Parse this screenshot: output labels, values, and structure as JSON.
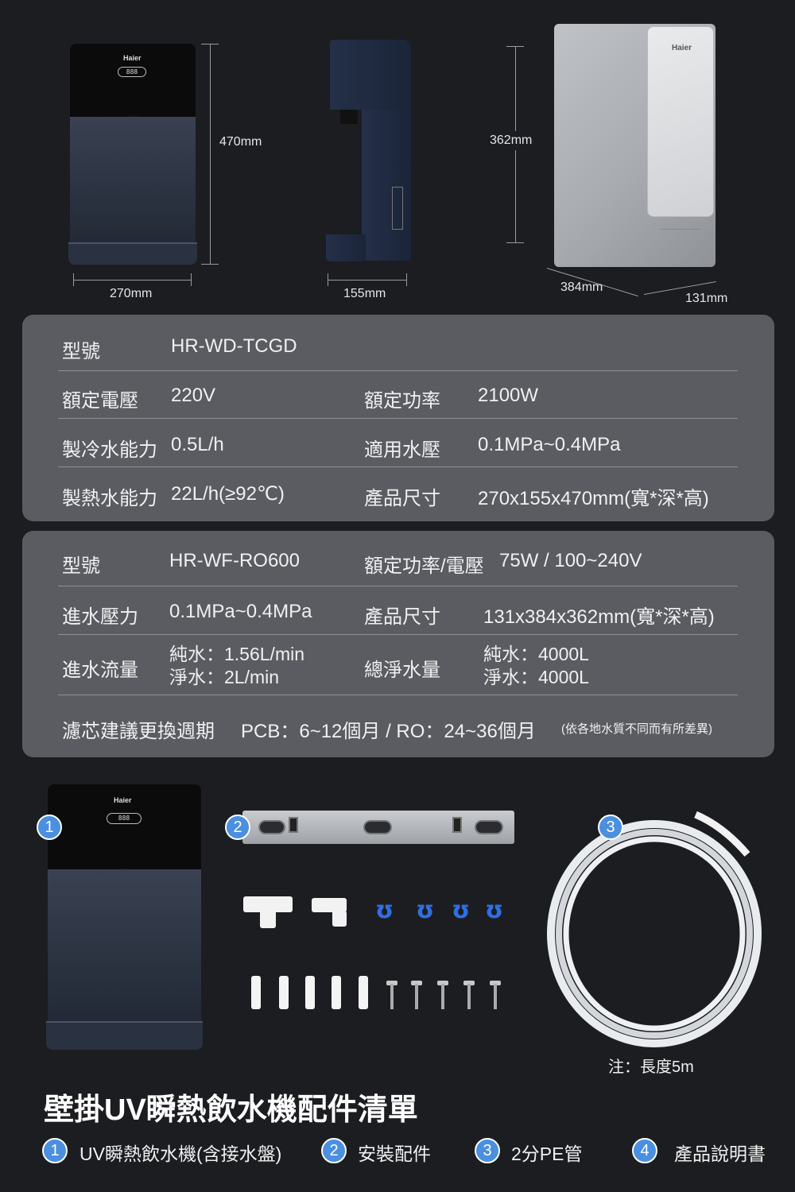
{
  "dimensions": {
    "dispenser_height": "470mm",
    "dispenser_width": "270mm",
    "dispenser_depth": "155mm",
    "purifier_height": "362mm",
    "purifier_depth": "384mm",
    "purifier_width": "131mm",
    "brand": "Haier",
    "display": "888"
  },
  "spec_dispenser": {
    "model_label": "型號",
    "model_value": "HR-WD-TCGD",
    "rows": [
      {
        "label_a": "額定電壓",
        "value_a": "220V",
        "label_b": "額定功率",
        "value_b": "2100W"
      },
      {
        "label_a": "製冷水能力",
        "value_a": "0.5L/h",
        "label_b": "適用水壓",
        "value_b": "0.1MPa~0.4MPa"
      },
      {
        "label_a": "製熱水能力",
        "value_a": "22L/h(≥92℃)",
        "label_b": "產品尺寸",
        "value_b": "270x155x470mm(寬*深*高)"
      }
    ]
  },
  "spec_purifier": {
    "model_label": "型號",
    "model_value": "HR-WF-RO600",
    "power_label": "額定功率/電壓",
    "power_value": "75W / 100~240V",
    "pressure_label": "進水壓力",
    "pressure_value": "0.1MPa~0.4MPa",
    "size_label": "產品尺寸",
    "size_value": "131x384x362mm(寬*深*高)",
    "flow_label": "進水流量",
    "flow_line1": "純水：1.56L/min",
    "flow_line2": "淨水：2L/min",
    "total_label": "總淨水量",
    "total_line1": "純水：4000L",
    "total_line2": "淨水：4000L",
    "filter_label": "濾芯建議更換週期",
    "filter_value": "PCB：6~12個月 / RO：24~36個月",
    "filter_note": "(依各地水質不同而有所差異)"
  },
  "accessories": {
    "markers": [
      "1",
      "2",
      "3"
    ],
    "pipe_note": "注：長度5m",
    "title": "壁掛UV瞬熱飲水機配件清單",
    "legend": [
      {
        "num": "1",
        "text": "UV瞬熱飲水機(含接水盤)"
      },
      {
        "num": "2",
        "text": "安裝配件"
      },
      {
        "num": "3",
        "text": "2分PE管"
      },
      {
        "num": "4",
        "text": "產品說明書"
      }
    ],
    "clip_glyph": "ʊ"
  },
  "colors": {
    "background": "#1c1d21",
    "panel": "#5a5c61",
    "accent_blue": "#4a8fe0",
    "clip_blue": "#2f6fe0"
  }
}
